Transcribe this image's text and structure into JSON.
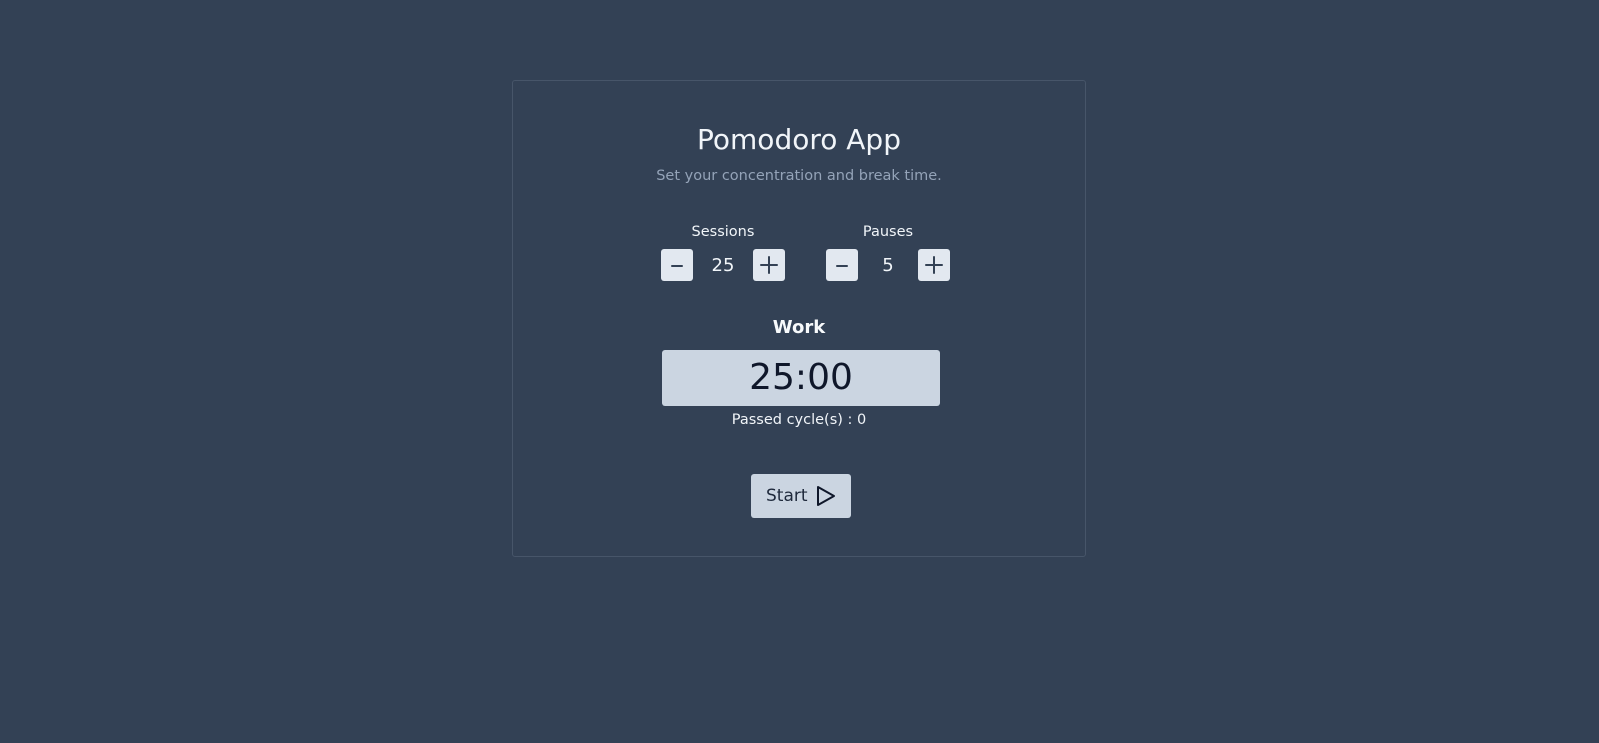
{
  "app": {
    "title": "Pomodoro App",
    "subtitle": "Set your concentration and break time."
  },
  "sessions": {
    "label": "Sessions",
    "value": "25",
    "decrement_icon": "minus-icon",
    "increment_icon": "plus-icon"
  },
  "pauses": {
    "label": "Pauses",
    "value": "5",
    "decrement_icon": "minus-icon",
    "increment_icon": "plus-icon"
  },
  "timer": {
    "mode": "Work",
    "display": "25:00",
    "cycles_text": "Passed cycle(s) : 0"
  },
  "controls": {
    "start_label": "Start",
    "start_icon": "play-icon"
  },
  "colors": {
    "background": "#334155",
    "card_border": "#475569",
    "button_light": "#e2e8f0",
    "timer_bg": "#cbd5e1",
    "text_primary": "#f1f5f9",
    "text_muted": "#94a3b8",
    "text_dark": "#0f172a"
  }
}
